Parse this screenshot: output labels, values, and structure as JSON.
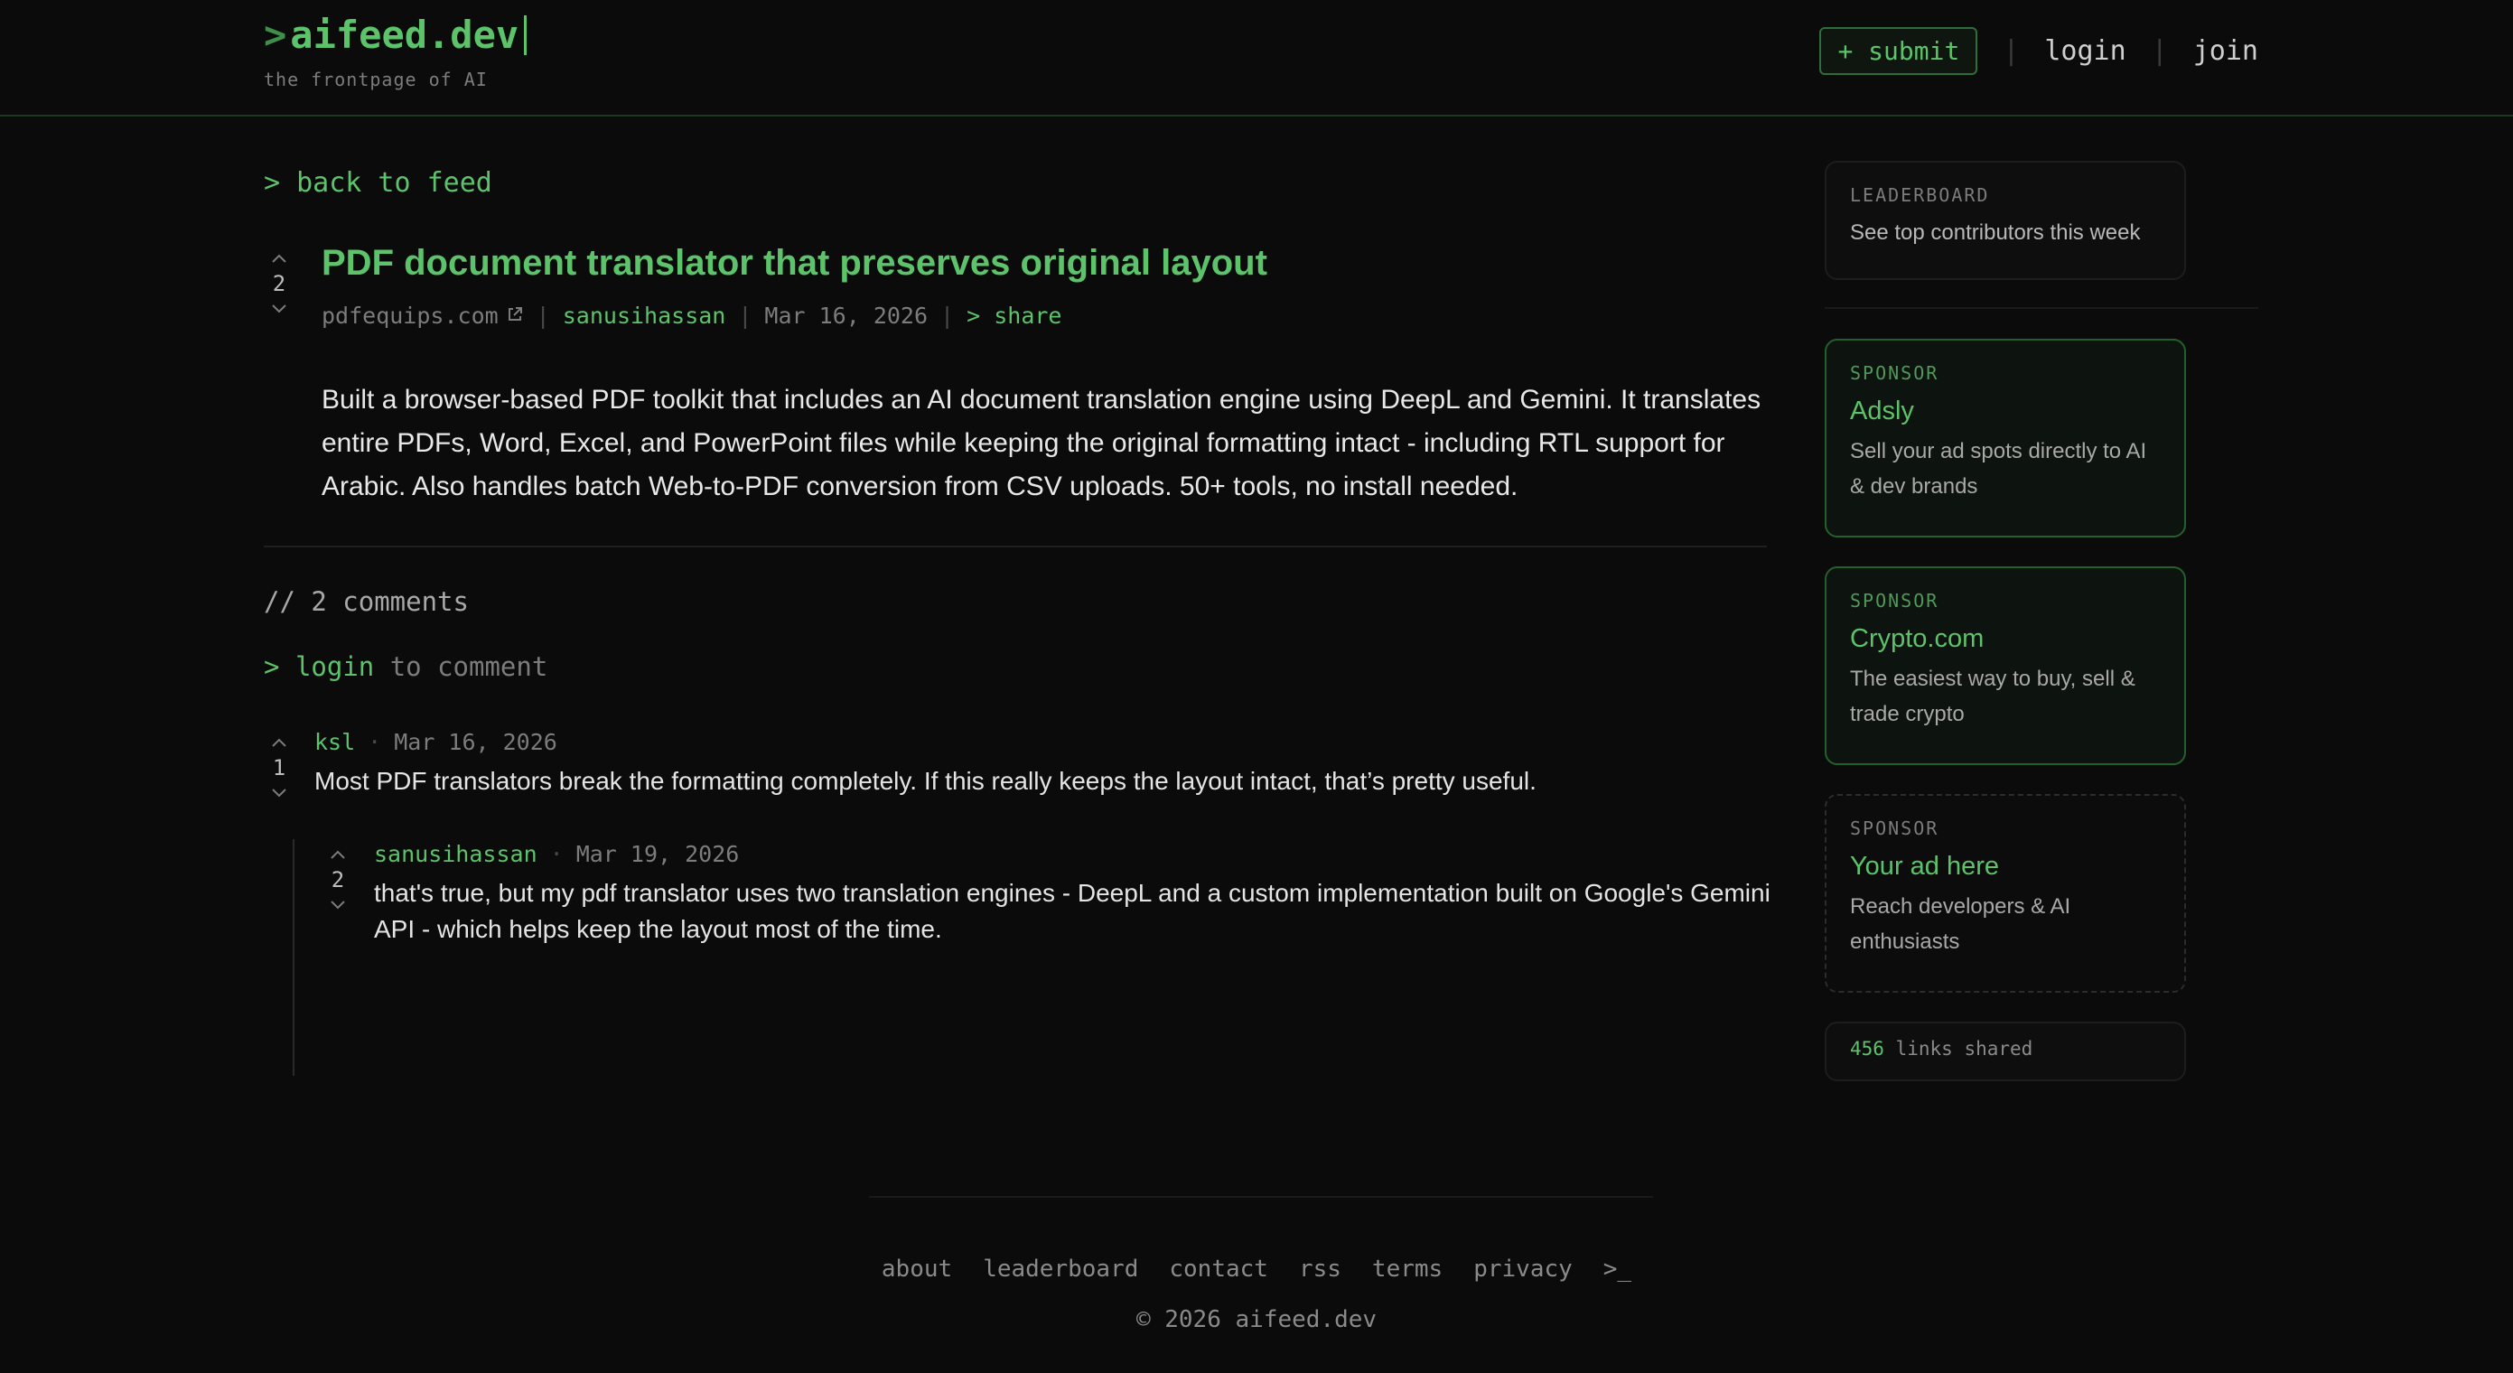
{
  "header": {
    "logo_prompt": ">",
    "logo_text": "aifeed.dev",
    "tagline": "the frontpage of AI",
    "submit_label": "+ submit",
    "login_label": "login",
    "join_label": "join",
    "separator": "|"
  },
  "post": {
    "back_label": "> back to feed",
    "votes": "2",
    "title": "PDF document translator that preserves original layout",
    "domain": "pdfequips.com",
    "author": "sanusihassan",
    "date": "Mar 16, 2026",
    "share_label": "> share",
    "body": "Built a browser-based PDF toolkit that includes an AI document translation engine using DeepL and Gemini. It translates entire PDFs, Word, Excel, and PowerPoint files while keeping the original formatting intact - including RTL support for Arabic. Also handles batch Web-to-PDF conversion from CSV uploads. 50+ tools, no install needed."
  },
  "comments_section": {
    "heading": "// 2 comments",
    "login_prompt": ">",
    "login_link": "login",
    "login_suffix": "to comment",
    "comments": [
      {
        "author": "ksl",
        "date": "Mar 16, 2026",
        "votes": "1",
        "text": "Most PDF translators break the formatting completely. If this really keeps the layout intact, that’s pretty useful."
      },
      {
        "author": "sanusihassan",
        "date": "Mar 19, 2026",
        "votes": "2",
        "text": "that's true, but my pdf translator uses two translation engines - DeepL and a custom implementation built on Google's Gemini API - which helps keep the layout most of the time."
      }
    ]
  },
  "sidebar": {
    "leaderboard": {
      "label": "LEADERBOARD",
      "desc": "See top contributors this week"
    },
    "sponsors": [
      {
        "label": "SPONSOR",
        "name": "Adsly",
        "desc": "Sell your ad spots directly to AI & dev brands"
      },
      {
        "label": "SPONSOR",
        "name": "Crypto.com",
        "desc": "The easiest way to buy, sell & trade crypto"
      },
      {
        "label": "SPONSOR",
        "name": "Your ad here",
        "desc": "Reach developers & AI enthusiasts"
      }
    ],
    "stats": {
      "count": "456",
      "label": "links shared"
    }
  },
  "footer": {
    "links": [
      "about",
      "leaderboard",
      "contact",
      "rss",
      "terms",
      "privacy",
      ">_"
    ],
    "copyright": "© 2026 aifeed.dev"
  },
  "colors": {
    "background": "#0b0b0b",
    "accent_green": "#5cc36a",
    "muted": "#7c7c7c"
  }
}
